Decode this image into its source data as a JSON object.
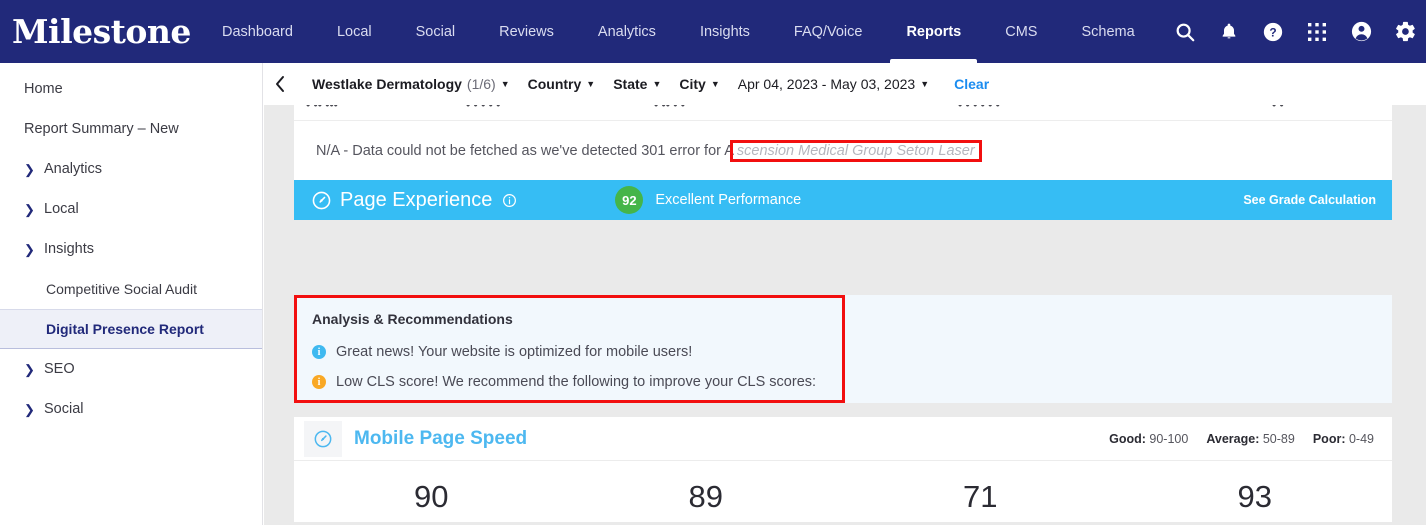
{
  "topnav": {
    "brand": "Milestone",
    "items": [
      {
        "label": "Dashboard",
        "active": false
      },
      {
        "label": "Local",
        "active": false
      },
      {
        "label": "Social",
        "active": false
      },
      {
        "label": "Reviews",
        "active": false
      },
      {
        "label": "Analytics",
        "active": false
      },
      {
        "label": "Insights",
        "active": false
      },
      {
        "label": "FAQ/Voice",
        "active": false
      },
      {
        "label": "Reports",
        "active": true
      },
      {
        "label": "CMS",
        "active": false
      },
      {
        "label": "Schema",
        "active": false
      }
    ],
    "icons": [
      "search-icon",
      "notification-bell-icon",
      "help-icon",
      "apps-grid-icon",
      "account-icon",
      "settings-gear-icon"
    ],
    "brand_color": "#21297a"
  },
  "sidebar": {
    "items": [
      {
        "label": "Home",
        "type": "leaf"
      },
      {
        "label": "Report Summary – New",
        "type": "leaf"
      },
      {
        "label": "Analytics",
        "type": "group",
        "expanded": false
      },
      {
        "label": "Local",
        "type": "group",
        "expanded": false
      },
      {
        "label": "Insights",
        "type": "group",
        "expanded": true
      },
      {
        "label": "Competitive Social Audit",
        "type": "child"
      },
      {
        "label": "Digital Presence Report",
        "type": "child",
        "selected": true
      },
      {
        "label": "SEO",
        "type": "group",
        "expanded": false
      },
      {
        "label": "Social",
        "type": "group",
        "expanded": false
      }
    ]
  },
  "filterbar": {
    "collapse_icon": "chevron-left-icon",
    "account": "Westlake Dermatology",
    "account_count": "(1/6)",
    "country": "Country",
    "state": "State",
    "city": "City",
    "daterange": "Apr 04, 2023 - May 03, 2023",
    "clear": "Clear"
  },
  "content": {
    "table_fragment": [
      "• •• •••",
      "• • • • •",
      "• •• • •",
      "• • • • • •",
      "• •"
    ],
    "na_message_prefix": "N/A - Data could not be fetched as we've detected 301 error for A",
    "na_message_highlight": "scension Medical Group Seton Laser",
    "page_experience": {
      "icon": "speedometer-icon",
      "title": "Page Experience",
      "info_icon": "info-circle-icon",
      "score": "92",
      "score_color": "#45b549",
      "performance_label": "Excellent Performance",
      "grade_link": "See Grade Calculation",
      "bar_color": "#36bdf4"
    },
    "analysis": {
      "title": "Analysis & Recommendations",
      "highlight_color": "#f20f0f",
      "items": [
        {
          "icon": "info-circle-icon",
          "color": "#3fb9f0",
          "text": "Great news! Your website is optimized for mobile users!"
        },
        {
          "icon": "info-circle-icon",
          "color": "#f9a825",
          "text": "Low CLS score! We recommend the following to improve your CLS scores:"
        }
      ]
    },
    "mobile_page_speed": {
      "icon": "speedometer-icon",
      "title": "Mobile Page Speed",
      "title_color": "#4db8f0",
      "legend": [
        {
          "label": "Good:",
          "range": "90-100"
        },
        {
          "label": "Average:",
          "range": "50-89"
        },
        {
          "label": "Poor:",
          "range": "0-49"
        }
      ],
      "scores": [
        "90",
        "89",
        "71",
        "93"
      ]
    }
  }
}
